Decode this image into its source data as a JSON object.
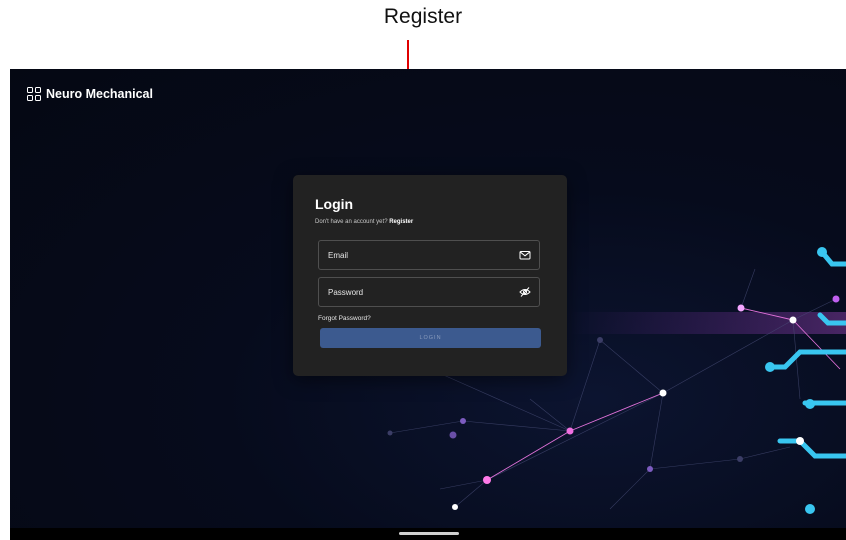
{
  "annotation": {
    "label": "Register"
  },
  "header": {
    "brand_name": "Neuro Mechanical",
    "brand_icon": "grid-icon"
  },
  "login": {
    "title": "Login",
    "subtitle_prefix": "Don't have an account yet?",
    "register_link": "Register",
    "email_placeholder": "Email",
    "email_icon": "mail-icon",
    "password_placeholder": "Password",
    "password_icon": "eye-off-icon",
    "forgot_password": "Forgot Password?",
    "login_button": "LOGIN"
  },
  "colors": {
    "background": "#050813",
    "card": "#222222",
    "button": "#3c5a8f",
    "annotation_arrow": "#e00000"
  }
}
